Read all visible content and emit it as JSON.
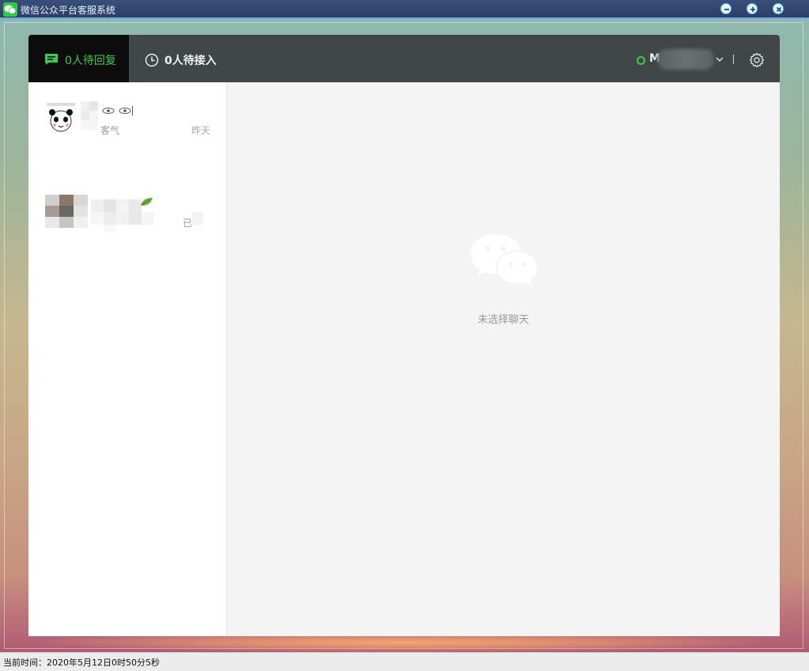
{
  "window": {
    "title": "微信公众平台客服系统",
    "icon": "wechat-icon",
    "controls": [
      "minimize-icon",
      "maximize-icon",
      "close-icon"
    ]
  },
  "topbar": {
    "tab_reply_label": "0人待回复",
    "tab_reply_icon": "chat-bubble-icon",
    "tab_waiting_label": "0人待接入",
    "tab_waiting_icon": "clock-icon",
    "user_initial": "M",
    "status_color": "#3ccb4a",
    "settings_icon": "gear-icon"
  },
  "conversations": [
    {
      "name": "",
      "preview": "客气",
      "time": "昨天"
    },
    {
      "name": "",
      "preview": "已",
      "time": ""
    }
  ],
  "empty_state": {
    "icon": "wechat-logo-icon",
    "text": "未选择聊天"
  },
  "statusbar": {
    "label": "当前时间：2020年5月12日0时50分5秒"
  },
  "colors": {
    "accent": "#3ccb4a",
    "topbar_bg": "#414748",
    "active_tab_bg": "#0c0c0c"
  }
}
